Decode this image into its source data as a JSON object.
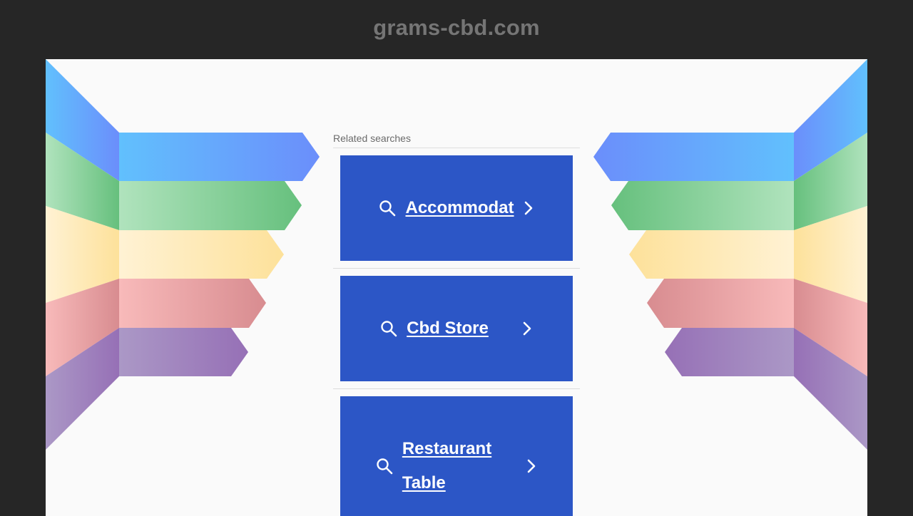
{
  "header": {
    "domain": "grams-cbd.com"
  },
  "related": {
    "label": "Related searches",
    "items": [
      {
        "label": "Accommodat"
      },
      {
        "label": "Cbd Store"
      },
      {
        "label_line1": "Restaurant",
        "label_line2": "Table"
      }
    ]
  },
  "icons": {
    "search": "search-icon",
    "chevron": "chevron-right-icon"
  },
  "colors": {
    "page_bg": "#262626",
    "panel_bg": "#fafafa",
    "tile_bg": "#2c56c6",
    "domain_text": "#757575",
    "ribbon_blue": "#62bdfc",
    "ribbon_green": "#6cc581",
    "ribbon_yellow": "#fde39b",
    "ribbon_red": "#f6b6b6",
    "ribbon_purple": "#9a70b7"
  }
}
